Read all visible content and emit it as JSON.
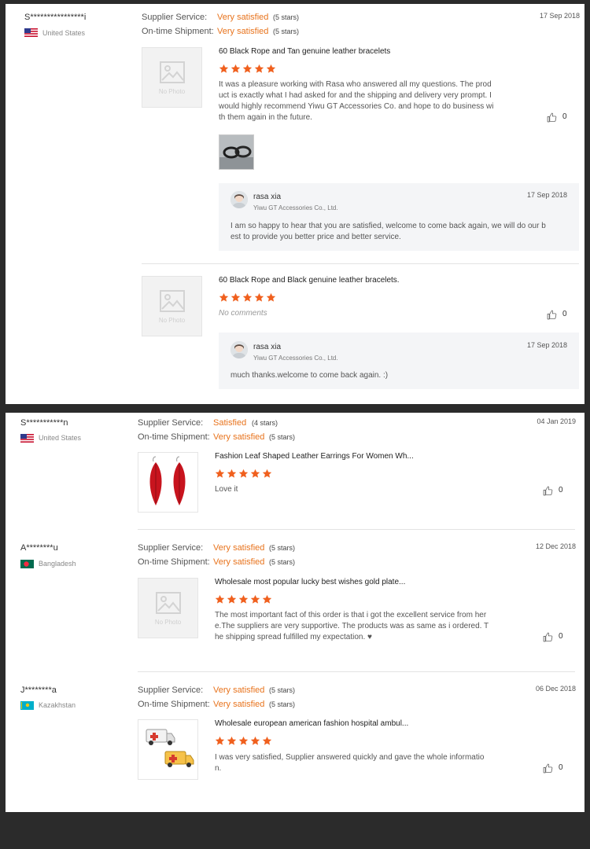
{
  "colors": {
    "accent": "#e8731c",
    "star": "#f0601e"
  },
  "labels": {
    "supplier_service": "Supplier Service:",
    "ontime_shipment": "On-time Shipment:",
    "no_photo": "No Photo"
  },
  "panel1": {
    "user": "S****************i",
    "country": "United States",
    "supplier_rating": "Very satisfied",
    "supplier_stars": "(5 stars)",
    "shipment_rating": "Very satisfied",
    "shipment_stars": "(5 stars)",
    "date": "17 Sep 2018",
    "items": [
      {
        "title": "60 Black Rope and Tan genuine leather bracelets",
        "stars": 5,
        "review_lines": [
          "It was a pleasure working with Rasa who answered all my questions. The prod",
          "uct is exactly what I had asked for and the shipping and delivery very prompt. I",
          "would highly recommend Yiwu GT Accessories Co. and hope to do business wi",
          "th them again in the future."
        ],
        "likes": "0",
        "reply": {
          "name": "rasa xia",
          "company": "Yiwu GT Accessories Co., Ltd.",
          "date": "17 Sep 2018",
          "text_lines": [
            "I am so happy to hear that you are satisfied, welcome to come back again, we will do our b",
            "est to provide you better price and better service."
          ]
        }
      },
      {
        "title": "60 Black Rope and Black genuine leather bracelets.",
        "stars": 5,
        "no_comments": "No comments",
        "likes": "0",
        "reply": {
          "name": "rasa xia",
          "company": "Yiwu GT Accessories Co., Ltd.",
          "date": "17 Sep 2018",
          "text_lines": [
            "much thanks.welcome to come back again. :)"
          ]
        }
      }
    ]
  },
  "panel2": {
    "reviews": [
      {
        "user": "S***********n",
        "country": "United States",
        "supplier_rating": "Satisfied",
        "supplier_stars": "(4 stars)",
        "shipment_rating": "Very satisfied",
        "shipment_stars": "(5 stars)",
        "date": "04 Jan 2019",
        "title": "Fashion Leaf Shaped Leather Earrings For Women Wh...",
        "stars": 5,
        "review_lines": [
          "Love it"
        ],
        "likes": "0"
      },
      {
        "user": "A********u",
        "country": "Bangladesh",
        "supplier_rating": "Very satisfied",
        "supplier_stars": "(5 stars)",
        "shipment_rating": "Very satisfied",
        "shipment_stars": "(5 stars)",
        "date": "12 Dec 2018",
        "title": "Wholesale most popular lucky best wishes gold plate...",
        "stars": 5,
        "review_lines": [
          "The most important fact of this order is that i got the excellent service from her",
          "e.The suppliers  are very supportive. The products was as same as i ordered. T",
          "he shipping spread fulfilled my expectation. ♥"
        ],
        "likes": "0"
      },
      {
        "user": "J********a",
        "country": "Kazakhstan",
        "supplier_rating": "Very satisfied",
        "supplier_stars": "(5 stars)",
        "shipment_rating": "Very satisfied",
        "shipment_stars": "(5 stars)",
        "date": "06 Dec 2018",
        "title": "Wholesale european american fashion hospital ambul...",
        "stars": 5,
        "review_lines": [
          "I was very satisfied, Supplier answered quickly and gave the whole informatio",
          "n."
        ],
        "likes": "0"
      }
    ]
  }
}
